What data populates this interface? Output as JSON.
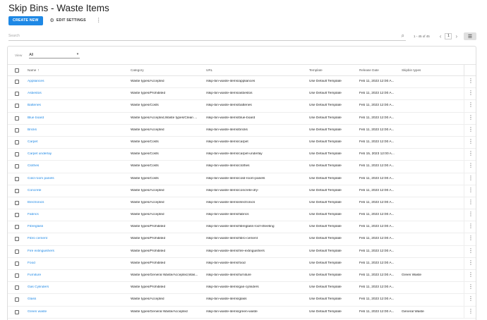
{
  "header": {
    "title": "Skip Bins - Waste Items"
  },
  "toolbar": {
    "create_label": "CREATE NEW",
    "edit_settings_label": "EDIT SETTINGS",
    "more_glyph": "⋮"
  },
  "search": {
    "placeholder": "Search"
  },
  "pagination": {
    "range": "1 - 45 of 45",
    "page": "1"
  },
  "filter": {
    "label": "View",
    "value": "All"
  },
  "table": {
    "columns": {
      "name": "Name",
      "category": "Category",
      "url": "URL",
      "template": "Template",
      "release_date": "Release Date",
      "skipbin_types": "Skipbin types"
    },
    "rows": [
      {
        "name": "Appliances",
        "category": "Waste types/Accepted",
        "url": "/skip-bin-waste-items/appliances",
        "template": "Use Default Template",
        "release": "Feb 11, 2023 12:00 A...",
        "types": ""
      },
      {
        "name": "Asbestos",
        "category": "Waste types/Prohibited",
        "url": "/skip-bin-waste-items/asbestos",
        "template": "Use Default Template",
        "release": "Feb 11, 2023 12:00 A...",
        "types": ""
      },
      {
        "name": "Batteries",
        "category": "Waste types/Costs",
        "url": "/skip-bin-waste-items/batteries",
        "template": "Use Default Template",
        "release": "Feb 11, 2023 12:00 A...",
        "types": ""
      },
      {
        "name": "Blue board",
        "category": "Waste types/Accepted,Waste types/Clean ...",
        "url": "/skip-bin-waste-items/blue-board",
        "template": "Use Default Template",
        "release": "Feb 11, 2023 12:00 A...",
        "types": ""
      },
      {
        "name": "Bricks",
        "category": "Waste types/Accepted",
        "url": "/skip-bin-waste-items/bricks",
        "template": "Use Default Template",
        "release": "Feb 11, 2023 12:00 A...",
        "types": ""
      },
      {
        "name": "Carpet",
        "category": "Waste types/Costs",
        "url": "/skip-bin-waste-items/carpet",
        "template": "Use Default Template",
        "release": "Feb 11, 2023 12:00 A...",
        "types": ""
      },
      {
        "name": "Carpet underlay",
        "category": "Waste types/Costs",
        "url": "/skip-bin-waste-items/carpet-underlay",
        "template": "Use Default Template",
        "release": "Feb 15, 2023 12:00 A...",
        "types": ""
      },
      {
        "name": "Clothes",
        "category": "Waste types/Costs",
        "url": "/skip-bin-waste-items/clothes",
        "template": "Use Default Template",
        "release": "Feb 11, 2023 12:00 A...",
        "types": ""
      },
      {
        "name": "Cold room panels",
        "category": "Waste types/Costs",
        "url": "/skip-bin-waste-items/cold-room-panels",
        "template": "Use Default Template",
        "release": "Feb 11, 2023 12:00 A...",
        "types": ""
      },
      {
        "name": "Concrete",
        "category": "Waste types/Accepted",
        "url": "/skip-bin-waste-items/concrete-dry-",
        "template": "Use Default Template",
        "release": "Feb 11, 2023 12:00 A...",
        "types": ""
      },
      {
        "name": "Electronics",
        "category": "Waste types/Accepted",
        "url": "/skip-bin-waste-items/electronics",
        "template": "Use Default Template",
        "release": "Feb 11, 2023 12:00 A...",
        "types": ""
      },
      {
        "name": "Fabrics",
        "category": "Waste types/Accepted",
        "url": "/skip-bin-waste-items/fabrics",
        "template": "Use Default Template",
        "release": "Feb 11, 2023 12:00 A...",
        "types": ""
      },
      {
        "name": "Fibreglass",
        "category": "Waste types/Prohibited",
        "url": "/skip-bin-waste-items/fibreglass-roof-sheeting",
        "template": "Use Default Template",
        "release": "Feb 11, 2023 12:00 A...",
        "types": ""
      },
      {
        "name": "Fibro cement",
        "category": "Waste types/Prohibited",
        "url": "/skip-bin-waste-items/fibro-cement",
        "template": "Use Default Template",
        "release": "Feb 11, 2023 12:00 A...",
        "types": ""
      },
      {
        "name": "Fire extinguishers",
        "category": "Waste types/Prohibited",
        "url": "/skip-bin-waste-items/fire-extinguishers",
        "template": "Use Default Template",
        "release": "Feb 11, 2023 12:00 A...",
        "types": ""
      },
      {
        "name": "Food",
        "category": "Waste types/Prohibited",
        "url": "/skip-bin-waste-items/food",
        "template": "Use Default Template",
        "release": "Feb 11, 2023 12:00 A...",
        "types": ""
      },
      {
        "name": "Furniture",
        "category": "Waste types/General Waste/Accepted,Was...",
        "url": "/skip-bin-waste-items/furniture",
        "template": "Use Default Template",
        "release": "Feb 11, 2023 12:00 A...",
        "types": "Green Waste"
      },
      {
        "name": "Gas Cylinders",
        "category": "Waste types/Prohibited",
        "url": "/skip-bin-waste-items/gas-cylinders",
        "template": "Use Default Template",
        "release": "Feb 11, 2023 12:00 A...",
        "types": ""
      },
      {
        "name": "Glass",
        "category": "Waste types/Accepted",
        "url": "/skip-bin-waste-items/glass",
        "template": "Use Default Template",
        "release": "Feb 11, 2023 12:00 A...",
        "types": ""
      },
      {
        "name": "Green waste",
        "category": "Waste types/General Waste/Accepted",
        "url": "/skip-bin-waste-items/green-waste",
        "template": "Use Default Template",
        "release": "Feb 11, 2023 12:00 A...",
        "types": "General Waste"
      }
    ]
  }
}
